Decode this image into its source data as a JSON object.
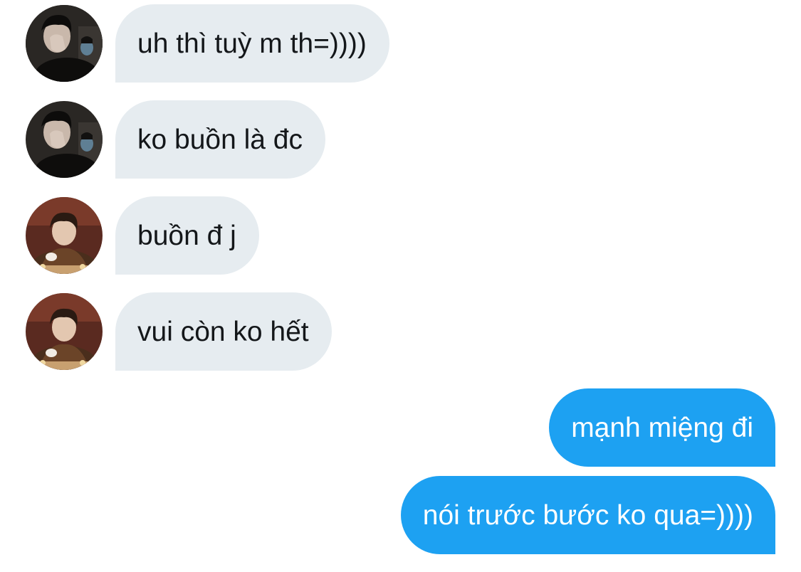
{
  "conversation": {
    "messages": [
      {
        "sender": "them",
        "avatar_icon": "user-avatar-a-icon",
        "text": "uh thì tuỳ m th=))))"
      },
      {
        "sender": "them",
        "avatar_icon": "user-avatar-a-icon",
        "text": "ko buồn là đc"
      },
      {
        "sender": "them",
        "avatar_icon": "user-avatar-b-icon",
        "text": "buồn đ j"
      },
      {
        "sender": "them",
        "avatar_icon": "user-avatar-b-icon",
        "text": "vui còn ko hết"
      },
      {
        "sender": "me",
        "text": "mạnh miệng đi"
      },
      {
        "sender": "me",
        "text": "nói trước bước ko qua=))))"
      }
    ]
  },
  "colors": {
    "incoming_bubble": "#e6ecf0",
    "incoming_text": "#14171a",
    "outgoing_bubble": "#1da1f2",
    "outgoing_text": "#ffffff",
    "background": "#ffffff"
  }
}
